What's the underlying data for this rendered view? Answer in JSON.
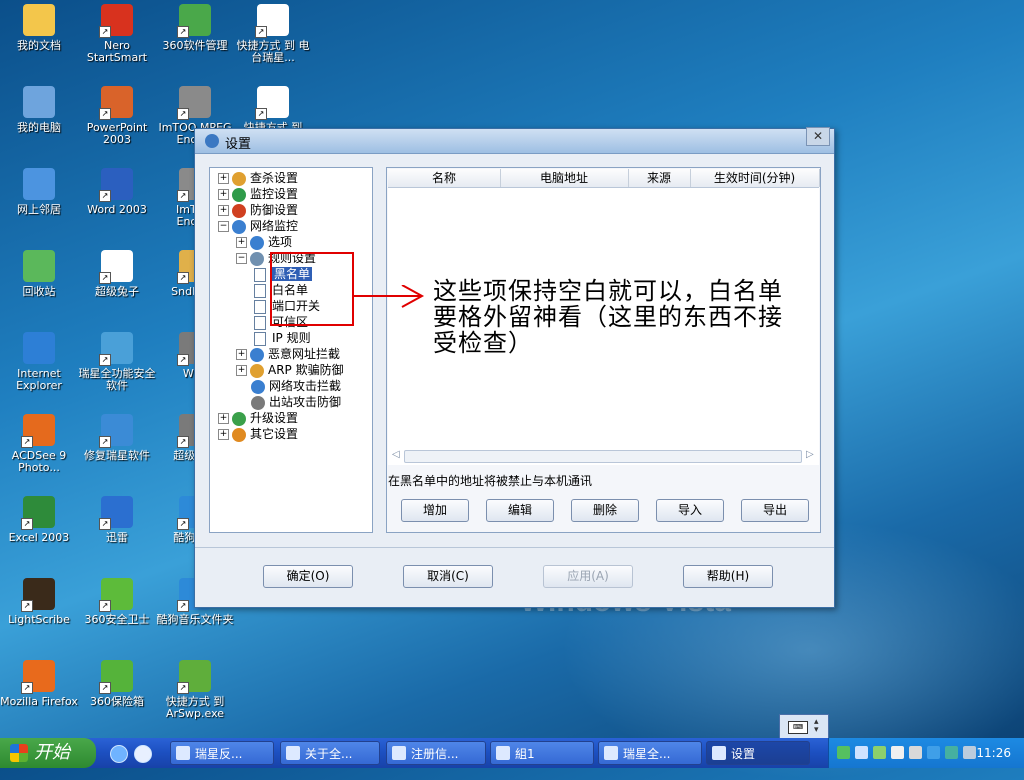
{
  "desktop": {
    "watermark": "Windows Vista",
    "icons": [
      {
        "label": "我的文档",
        "icon": "folder-docs-icon",
        "color": "#f3c64b"
      },
      {
        "label": "Nero StartSmart",
        "icon": "nero-icon",
        "color": "#d8321e"
      },
      {
        "label": "360软件管理",
        "icon": "software-manager-icon",
        "color": "#4aa84a"
      },
      {
        "label": "快捷方式 到 电台瑞星...",
        "icon": "shortcut-doc-icon",
        "color": "#ffffff"
      },
      {
        "label": "我的电脑",
        "icon": "my-computer-icon",
        "color": "#6ea4dd"
      },
      {
        "label": "PowerPoint 2003",
        "icon": "powerpoint-icon",
        "color": "#d9632a"
      },
      {
        "label": "ImTOO MPEG Enco...",
        "icon": "imtoo-icon",
        "color": "#8a8a8a"
      },
      {
        "label": "快捷方式 到",
        "icon": "shortcut-doc-icon",
        "color": "#ffffff"
      },
      {
        "label": "网上邻居",
        "icon": "network-icon",
        "color": "#4c94e0"
      },
      {
        "label": "Word 2003",
        "icon": "word-icon",
        "color": "#2b5fbf"
      },
      {
        "label": "ImTOO Enco...",
        "icon": "imtoo-icon",
        "color": "#8a8a8a"
      },
      {
        "label": "回收站",
        "icon": "recycle-bin-icon",
        "color": "#5bb85b"
      },
      {
        "label": "超级兔子",
        "icon": "rabbit-icon",
        "color": "#ffffff"
      },
      {
        "label": "SndMa...",
        "icon": "sound-icon",
        "color": "#e0b04a"
      },
      {
        "label": "Internet Explorer",
        "icon": "ie-icon",
        "color": "#2d7fd6"
      },
      {
        "label": "瑞星全功能安全软件",
        "icon": "rising-antivirus-icon",
        "color": "#4aa0d8"
      },
      {
        "label": "Wi...",
        "icon": "app-icon",
        "color": "#7a7a7a"
      },
      {
        "label": "ACDSee 9 Photo...",
        "icon": "acdsee-icon",
        "color": "#e56a1d"
      },
      {
        "label": "修复瑞星软件",
        "icon": "repair-icon",
        "color": "#3b8bd6"
      },
      {
        "label": "超级解...",
        "icon": "app-icon",
        "color": "#7a7a7a"
      },
      {
        "label": "Excel 2003",
        "icon": "excel-icon",
        "color": "#2e8b3a"
      },
      {
        "label": "迅雷",
        "icon": "thunder-icon",
        "color": "#2b6fd0"
      },
      {
        "label": "酷狗音...",
        "icon": "kugou-icon",
        "color": "#2d8ad8"
      },
      {
        "label": "LightScribe",
        "icon": "lightscribe-icon",
        "color": "#3a2a1a"
      },
      {
        "label": "360安全卫士",
        "icon": "360-safe-icon",
        "color": "#5dbb3a"
      },
      {
        "label": "酷狗音乐文件夹",
        "icon": "kugou-folder-icon",
        "color": "#2d8ad8"
      },
      {
        "label": "Mozilla Firefox",
        "icon": "firefox-icon",
        "color": "#e86a1c"
      },
      {
        "label": "360保险箱",
        "icon": "360-safebox-icon",
        "color": "#55b33a"
      },
      {
        "label": "快捷方式 到 ArSwp.exe",
        "icon": "arswp-icon",
        "color": "#5fae3b"
      }
    ]
  },
  "window": {
    "title": "设置",
    "close_glyph": "✕",
    "tree": [
      {
        "label": "查杀设置",
        "level": 0,
        "expander": "+",
        "selected": false,
        "icon_color": "#e0a030"
      },
      {
        "label": "监控设置",
        "level": 0,
        "expander": "+",
        "selected": false,
        "icon_color": "#2f9b4a"
      },
      {
        "label": "防御设置",
        "level": 0,
        "expander": "+",
        "selected": false,
        "icon_color": "#d04020"
      },
      {
        "label": "网络监控",
        "level": 0,
        "expander": "−",
        "selected": false,
        "icon_color": "#3a7fd0"
      },
      {
        "label": "选项",
        "level": 1,
        "expander": "+",
        "selected": false,
        "icon_color": "#3a7fd0"
      },
      {
        "label": "规则设置",
        "level": 1,
        "expander": "−",
        "selected": false,
        "icon_color": "#7090b0"
      },
      {
        "label": "黑名单",
        "level": 2,
        "expander": "",
        "selected": true,
        "icon_color": ""
      },
      {
        "label": "白名单",
        "level": 2,
        "expander": "",
        "selected": false,
        "icon_color": ""
      },
      {
        "label": "端口开关",
        "level": 2,
        "expander": "",
        "selected": false,
        "icon_color": ""
      },
      {
        "label": "可信区",
        "level": 2,
        "expander": "",
        "selected": false,
        "icon_color": ""
      },
      {
        "label": "IP 规则",
        "level": 2,
        "expander": "",
        "selected": false,
        "icon_color": ""
      },
      {
        "label": "恶意网址拦截",
        "level": 1,
        "expander": "+",
        "selected": false,
        "icon_color": "#3a7fd0"
      },
      {
        "label": "ARP 欺骗防御",
        "level": 1,
        "expander": "+",
        "selected": false,
        "icon_color": "#e0a030"
      },
      {
        "label": "网络攻击拦截",
        "level": 1,
        "expander": "",
        "selected": false,
        "icon_color": "#3a7fd0"
      },
      {
        "label": "出站攻击防御",
        "level": 1,
        "expander": "",
        "selected": false,
        "icon_color": "#7a7a7a"
      },
      {
        "label": "升级设置",
        "level": 0,
        "expander": "+",
        "selected": false,
        "icon_color": "#3aa04a"
      },
      {
        "label": "其它设置",
        "level": 0,
        "expander": "+",
        "selected": false,
        "icon_color": "#e08a20"
      }
    ],
    "list": {
      "columns": [
        "名称",
        "电脑地址",
        "来源",
        "生效时间(分钟)"
      ],
      "rows": []
    },
    "hint": "在黑名单中的地址将被禁止与本机通讯",
    "actions": [
      "增加",
      "编辑",
      "删除",
      "导入",
      "导出"
    ],
    "footer": {
      "ok": "确定(O)",
      "cancel": "取消(C)",
      "apply": "应用(A)",
      "help": "帮助(H)"
    }
  },
  "annotation": {
    "note": "这些项保持空白就可以，白名单要格外留神看（这里的东西不接受检查）",
    "color": "#e00000"
  },
  "taskbar": {
    "start_label": "开始",
    "tasks": [
      {
        "label": "瑞星反...",
        "active": false
      },
      {
        "label": "关于全...",
        "active": false
      },
      {
        "label": "注册信...",
        "active": false
      },
      {
        "label": "組1",
        "active": false
      },
      {
        "label": "瑞星全...",
        "active": false
      },
      {
        "label": "设置",
        "active": true
      }
    ],
    "clock": "11:26"
  }
}
